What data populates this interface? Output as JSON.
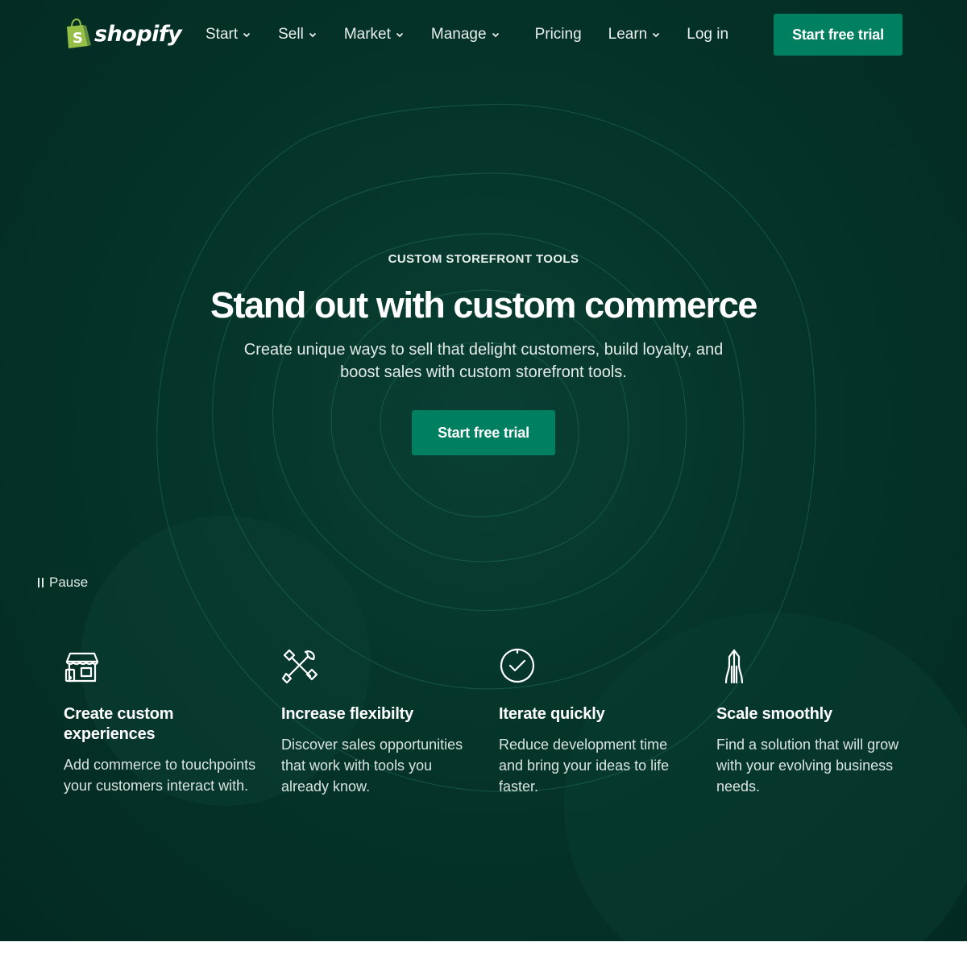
{
  "brand": {
    "name": "shopify"
  },
  "nav": {
    "items": [
      {
        "label": "Start",
        "has_dropdown": true
      },
      {
        "label": "Sell",
        "has_dropdown": true
      },
      {
        "label": "Market",
        "has_dropdown": true
      },
      {
        "label": "Manage",
        "has_dropdown": true
      },
      {
        "label": "Pricing",
        "has_dropdown": false
      },
      {
        "label": "Learn",
        "has_dropdown": true
      },
      {
        "label": "Log in",
        "has_dropdown": false
      }
    ],
    "cta_label": "Start free trial"
  },
  "hero": {
    "eyebrow": "CUSTOM STOREFRONT TOOLS",
    "title": "Stand out with custom commerce",
    "subtitle": "Create unique ways to sell that delight customers, build loyalty, and boost sales with custom storefront tools.",
    "cta_label": "Start free trial"
  },
  "pause_label": "Pause",
  "features": [
    {
      "icon": "storefront-icon",
      "title": "Create custom experiences",
      "description": "Add commerce to touchpoints your customers interact with."
    },
    {
      "icon": "tools-icon",
      "title": "Increase flexibilty",
      "description": "Discover sales opportunities that work with tools you already know."
    },
    {
      "icon": "check-circle-icon",
      "title": "Iterate quickly",
      "description": "Reduce development time and bring your ideas to life faster."
    },
    {
      "icon": "growth-arrows-icon",
      "title": "Scale smoothly",
      "description": "Find a solution that will grow with your evolving business needs."
    }
  ],
  "colors": {
    "background": "#053429",
    "accent": "#008060",
    "logo_bag": "#95bf47",
    "text": "#ffffff"
  }
}
